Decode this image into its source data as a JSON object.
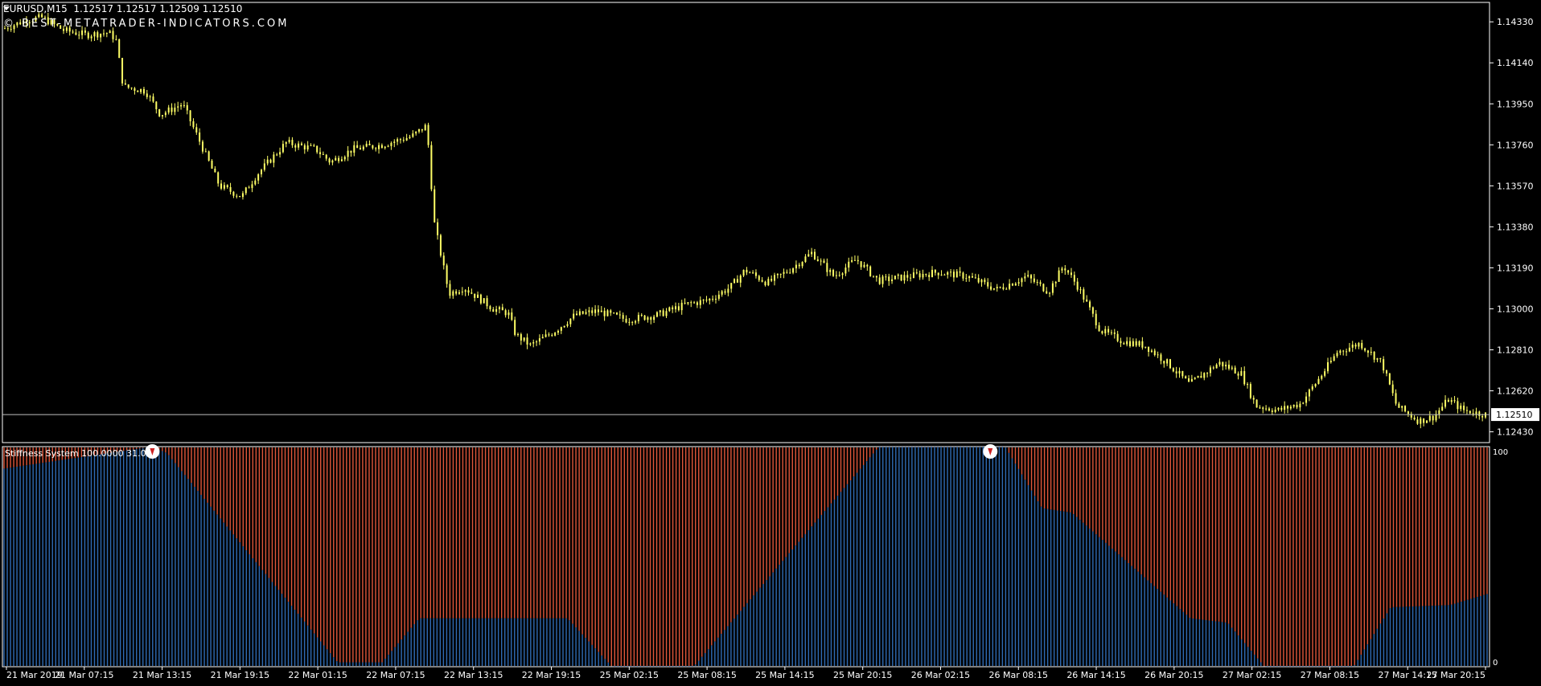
{
  "header": {
    "symbol_line": "EURUSD,M15  1.12517 1.12517 1.12509 1.12510",
    "watermark": "© BEST-METATRADER-INDICATORS.COM"
  },
  "colors": {
    "background": "#000000",
    "candles": "#FFFF66",
    "axis": "#FFFFFF",
    "bid_line": "#C0C0C0",
    "stiffness_blue": "#2F6BB3",
    "stiffness_red": "#E0573A"
  },
  "indicator": {
    "label": "Stiffness System 100.0000 31.0",
    "scale_top": "100",
    "scale_bottom": "0"
  },
  "chart_data": [
    {
      "type": "candlestick",
      "title": "EURUSD,M15",
      "price_axis_labels": [
        "1.14330",
        "1.14140",
        "1.13950",
        "1.13760",
        "1.13570",
        "1.13380",
        "1.13190",
        "1.13000",
        "1.12810",
        "1.12620",
        "1.12430"
      ],
      "ylim": [
        1.1238,
        1.1442
      ],
      "current_price": "1.12510",
      "x_labels": [
        "21 Mar 2019",
        "21 Mar 07:15",
        "21 Mar 13:15",
        "21 Mar 19:15",
        "22 Mar 01:15",
        "22 Mar 07:15",
        "22 Mar 13:15",
        "22 Mar 19:15",
        "25 Mar 02:15",
        "25 Mar 08:15",
        "25 Mar 14:15",
        "25 Mar 20:15",
        "26 Mar 02:15",
        "26 Mar 08:15",
        "26 Mar 14:15",
        "26 Mar 20:15",
        "27 Mar 02:15",
        "27 Mar 08:15",
        "27 Mar 14:15",
        "27 Mar 20:15"
      ],
      "close_path": [
        [
          0,
          1.143
        ],
        [
          0.015,
          1.1434
        ],
        [
          0.025,
          1.1435
        ],
        [
          0.04,
          1.1429
        ],
        [
          0.055,
          1.1427
        ],
        [
          0.07,
          1.1428
        ],
        [
          0.075,
          1.1425
        ],
        [
          0.08,
          1.1403
        ],
        [
          0.095,
          1.1401
        ],
        [
          0.105,
          1.139
        ],
        [
          0.12,
          1.1395
        ],
        [
          0.13,
          1.138
        ],
        [
          0.145,
          1.1357
        ],
        [
          0.16,
          1.1352
        ],
        [
          0.17,
          1.1362
        ],
        [
          0.19,
          1.1377
        ],
        [
          0.21,
          1.1374
        ],
        [
          0.22,
          1.1368
        ],
        [
          0.235,
          1.1374
        ],
        [
          0.255,
          1.1376
        ],
        [
          0.275,
          1.138
        ],
        [
          0.285,
          1.1385
        ],
        [
          0.29,
          1.134
        ],
        [
          0.3,
          1.1307
        ],
        [
          0.31,
          1.131
        ],
        [
          0.33,
          1.13
        ],
        [
          0.34,
          1.1298
        ],
        [
          0.345,
          1.1288
        ],
        [
          0.355,
          1.1283
        ],
        [
          0.37,
          1.1289
        ],
        [
          0.385,
          1.1297
        ],
        [
          0.4,
          1.1299
        ],
        [
          0.42,
          1.1295
        ],
        [
          0.44,
          1.1297
        ],
        [
          0.46,
          1.1302
        ],
        [
          0.475,
          1.1304
        ],
        [
          0.49,
          1.131
        ],
        [
          0.5,
          1.1318
        ],
        [
          0.515,
          1.1312
        ],
        [
          0.53,
          1.1318
        ],
        [
          0.545,
          1.1326
        ],
        [
          0.56,
          1.1315
        ],
        [
          0.575,
          1.1323
        ],
        [
          0.59,
          1.1313
        ],
        [
          0.61,
          1.1315
        ],
        [
          0.63,
          1.1317
        ],
        [
          0.65,
          1.1315
        ],
        [
          0.67,
          1.1309
        ],
        [
          0.69,
          1.1315
        ],
        [
          0.705,
          1.1308
        ],
        [
          0.715,
          1.132
        ],
        [
          0.725,
          1.131
        ],
        [
          0.74,
          1.129
        ],
        [
          0.755,
          1.1285
        ],
        [
          0.77,
          1.1283
        ],
        [
          0.785,
          1.1275
        ],
        [
          0.8,
          1.1265
        ],
        [
          0.82,
          1.1275
        ],
        [
          0.835,
          1.127
        ],
        [
          0.845,
          1.1255
        ],
        [
          0.86,
          1.1253
        ],
        [
          0.875,
          1.1256
        ],
        [
          0.89,
          1.127
        ],
        [
          0.9,
          1.128
        ],
        [
          0.915,
          1.1284
        ],
        [
          0.93,
          1.1275
        ],
        [
          0.94,
          1.1255
        ],
        [
          0.955,
          1.1248
        ],
        [
          0.965,
          1.125
        ],
        [
          0.975,
          1.1258
        ],
        [
          0.985,
          1.1253
        ],
        [
          1.0,
          1.1251
        ]
      ]
    },
    {
      "type": "bar",
      "title": "Stiffness System",
      "ylim": [
        0,
        100
      ],
      "series": [
        {
          "name": "",
          "points": [
            [
              0,
              90
            ],
            [
              0.1,
              100
            ],
            [
              0.11,
              97
            ],
            [
              0.225,
              2
            ],
            [
              0.255,
              2
            ],
            [
              0.28,
              22
            ],
            [
              0.38,
              22
            ],
            [
              0.41,
              0
            ],
            [
              0.465,
              0
            ],
            [
              0.59,
              100
            ],
            [
              0.675,
              100
            ],
            [
              0.7,
              72
            ],
            [
              0.72,
              70
            ],
            [
              0.8,
              22
            ],
            [
              0.825,
              20
            ],
            [
              0.85,
              0
            ],
            [
              0.91,
              0
            ],
            [
              0.935,
              27
            ],
            [
              0.975,
              28
            ],
            [
              1.0,
              33
            ]
          ]
        }
      ]
    }
  ]
}
